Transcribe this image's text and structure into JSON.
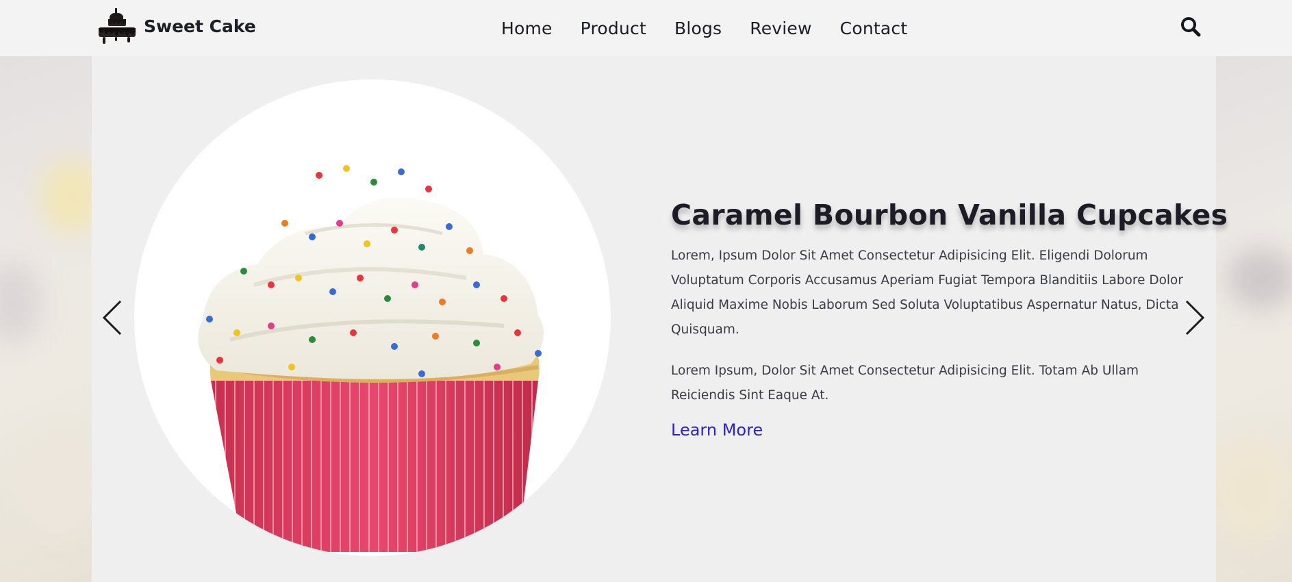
{
  "header": {
    "brand": "Sweet Cake",
    "logo_icon": "cake-drip-icon",
    "nav": [
      "Home",
      "Product",
      "Blogs",
      "Review",
      "Contact"
    ],
    "search_icon": "search-icon"
  },
  "slide": {
    "image_icon": "sprinkle-cupcake-image",
    "title": "Caramel Bourbon Vanilla Cupcakes",
    "paragraph1": "Lorem, Ipsum Dolor Sit Amet Consectetur Adipisicing Elit. Eligendi Dolorum Voluptatum Corporis Accusamus Aperiam Fugiat Tempora Blanditiis Labore Dolor Aliquid Maxime Nobis Laborum Sed Soluta Voluptatibus Aspernatur Natus, Dicta Quisquam.",
    "paragraph2": "Lorem Ipsum, Dolor Sit Amet Consectetur Adipisicing Elit. Totam Ab Ullam Reiciendis Sint Eaque At.",
    "link": "Learn More"
  },
  "colors": {
    "link": "#2a24c8",
    "panel": "#efefef",
    "header": "#f3f3f3",
    "cupcake_liner": "#e24468"
  }
}
